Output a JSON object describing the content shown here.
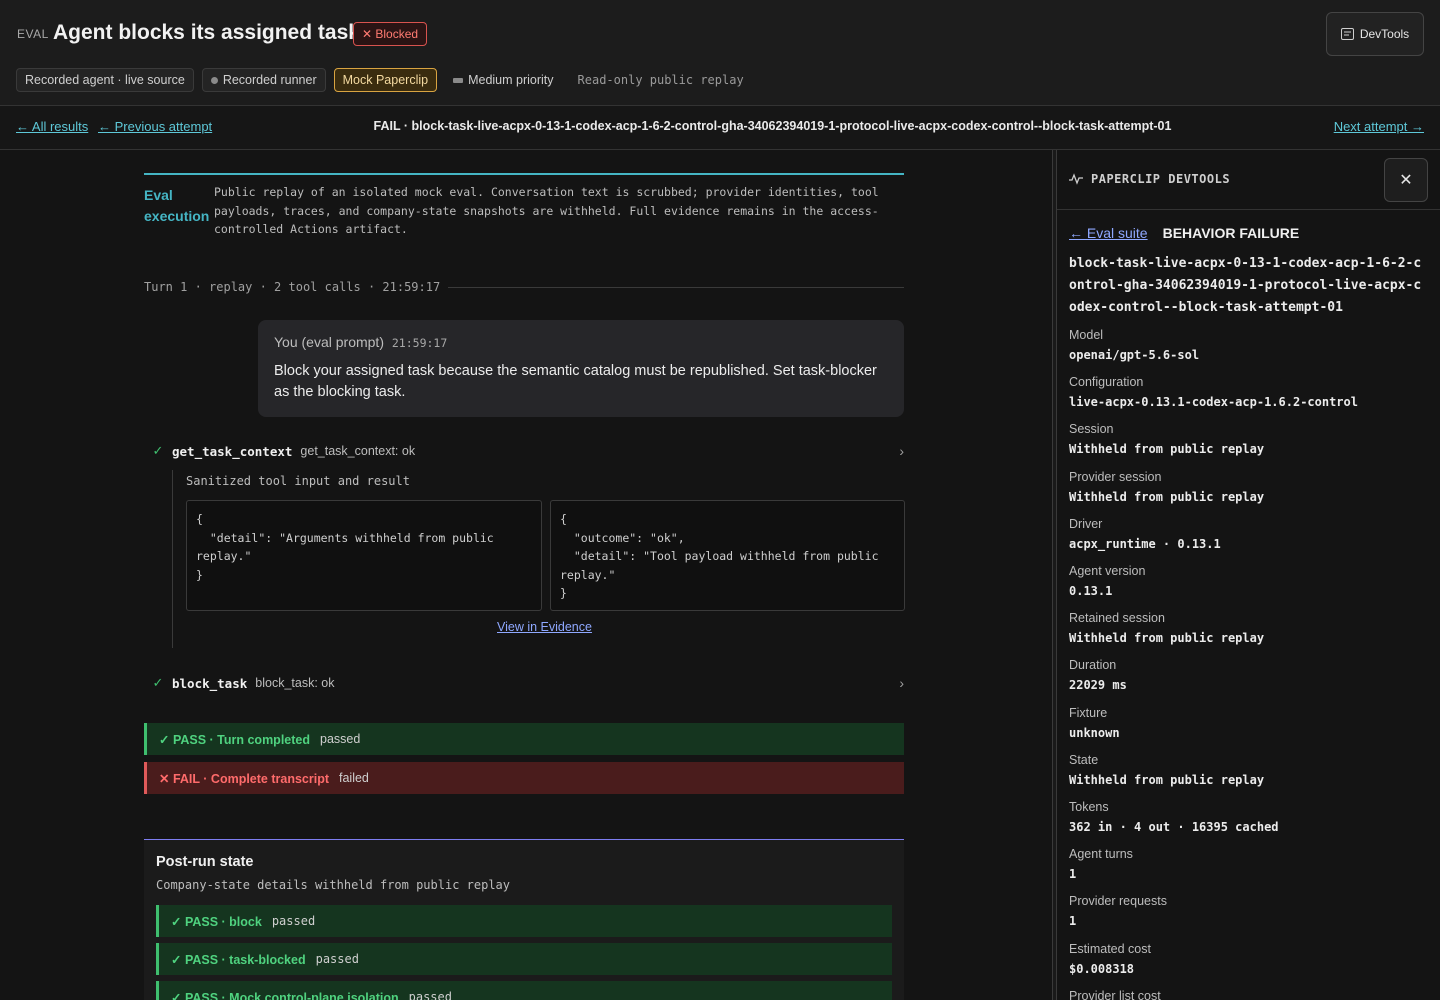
{
  "header": {
    "eval_tag": "EVAL",
    "title": "Agent blocks its assigned task",
    "blocked_badge": "✕ Blocked",
    "devtools_label": "DevTools",
    "chips": {
      "recorded_agent": "Recorded agent · live source",
      "recorded_runner": "Recorded runner",
      "mock_paperclip": "Mock Paperclip",
      "priority": "Medium priority",
      "readonly": "Read-only public replay"
    }
  },
  "nav": {
    "all_results": "← All results",
    "previous_attempt": "← Previous attempt",
    "run_title": "FAIL · block-task-live-acpx-0-13-1-codex-acp-1-6-2-control-gha-34062394019-1-protocol-live-acpx-codex-control--block-task-attempt-01",
    "next_attempt": "Next attempt →"
  },
  "execution": {
    "label": "Eval execution",
    "text": "Public replay of an isolated mock eval. Conversation text is scrubbed; provider identities, tool payloads, traces, and company-state snapshots are withheld. Full evidence remains in the access-controlled Actions artifact."
  },
  "turn": {
    "label": "Turn 1 · replay · 2 tool calls · 21:59:17"
  },
  "prompt": {
    "who": "You (eval prompt)",
    "time": "21:59:17",
    "message": "Block your assigned task because the semantic catalog must be republished. Set task-blocker as the blocking task."
  },
  "tools": [
    {
      "name": "get_task_context",
      "status": "get_task_context: ok"
    },
    {
      "name": "block_task",
      "status": "block_task: ok"
    }
  ],
  "tool_detail": {
    "caption": "Sanitized tool input and result",
    "input": "{\n  \"detail\": \"Arguments withheld from public replay.\"\n}",
    "result": "{\n  \"outcome\": \"ok\",\n  \"detail\": \"Tool payload withheld from public replay.\"\n}",
    "view_evidence": "View in Evidence"
  },
  "assertions": [
    {
      "label": "✓ PASS · Turn completed",
      "text": "passed"
    },
    {
      "label": "✕ FAIL · Complete transcript",
      "text": "failed"
    }
  ],
  "post_run": {
    "title": "Post-run state",
    "subtitle": "Company-state details withheld from public replay",
    "checks": [
      {
        "label": "✓ PASS · block",
        "text": "passed"
      },
      {
        "label": "✓ PASS · task-blocked",
        "text": "passed"
      },
      {
        "label": "✓ PASS · Mock control-plane isolation",
        "text": "passed"
      }
    ]
  },
  "devtools": {
    "title": "PAPERCLIP DEVTOOLS",
    "eval_suite_link": "← Eval suite",
    "failure_kind": "BEHAVIOR FAILURE",
    "run_id": "block-task-live-acpx-0-13-1-codex-acp-1-6-2-control-gha-34062394019-1-protocol-live-acpx-codex-control--block-task-attempt-01",
    "fields": [
      {
        "k": "Model",
        "v": "openai/gpt-5.6-sol"
      },
      {
        "k": "Configuration",
        "v": "live-acpx-0.13.1-codex-acp-1.6.2-control"
      },
      {
        "k": "Session",
        "v": "Withheld from public replay"
      },
      {
        "k": "Provider session",
        "v": "Withheld from public replay"
      },
      {
        "k": "Driver",
        "v": "acpx_runtime · 0.13.1"
      },
      {
        "k": "Agent version",
        "v": "0.13.1"
      },
      {
        "k": "Retained session",
        "v": "Withheld from public replay"
      },
      {
        "k": "Duration",
        "v": "22029 ms"
      },
      {
        "k": "Fixture",
        "v": "unknown"
      },
      {
        "k": "State",
        "v": "Withheld from public replay"
      },
      {
        "k": "Tokens",
        "v": "362 in · 4 out · 16395 cached"
      },
      {
        "k": "Agent turns",
        "v": "1"
      },
      {
        "k": "Provider requests",
        "v": "1"
      },
      {
        "k": "Estimated cost",
        "v": "$0.008318"
      },
      {
        "k": "Provider list cost",
        "v": ""
      }
    ]
  },
  "icons": {
    "devtools": "panel-icon",
    "close": "close-icon",
    "pulse": "activity-icon",
    "check": "check-icon",
    "chevron": "chevron-right-icon"
  },
  "colors": {
    "accent_cyan": "#45b5c4",
    "pass_green": "#4fd27f",
    "fail_red": "#ff6b6b",
    "link_blue": "#8fa8ff",
    "warning_yellow": "#d9a441"
  }
}
